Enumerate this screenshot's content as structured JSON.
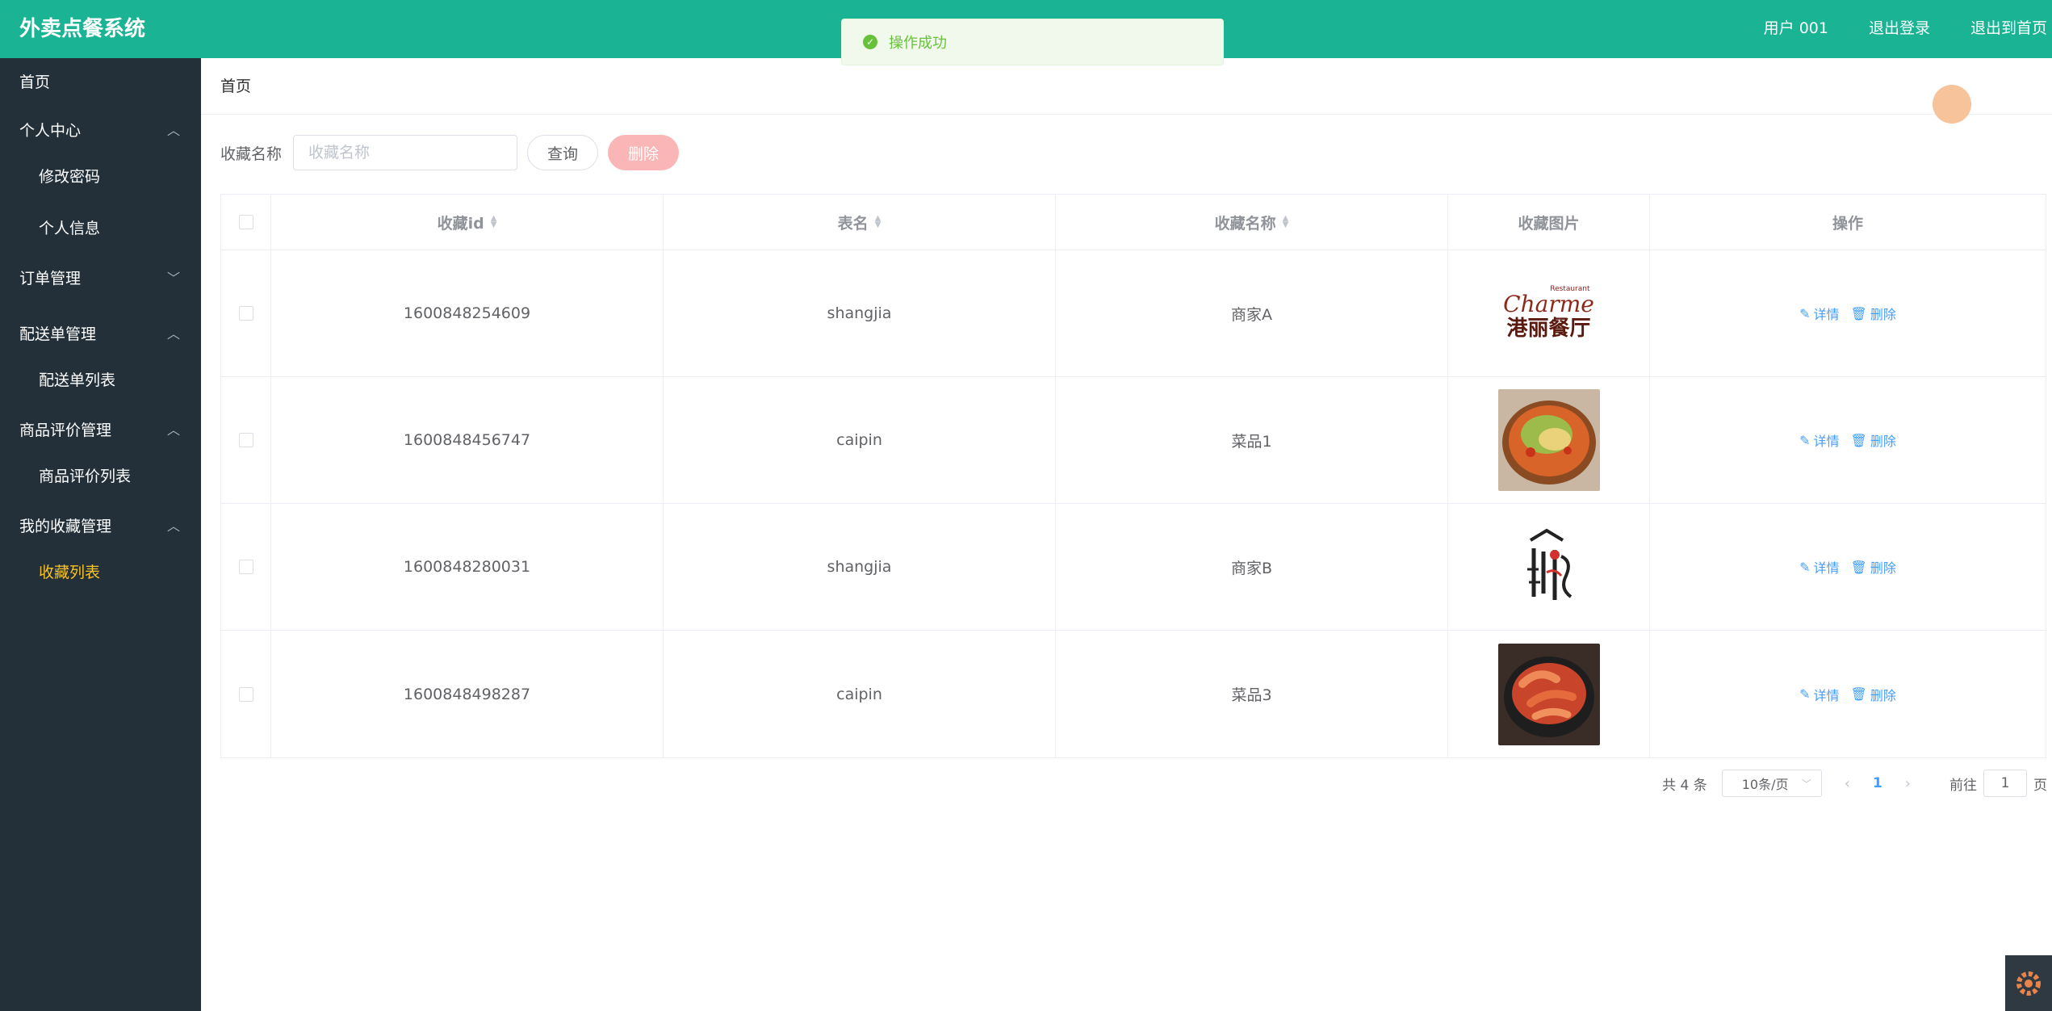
{
  "header": {
    "brand": "外卖点餐系统",
    "user": "用户 001",
    "logout": "退出登录",
    "exit_home": "退出到首页"
  },
  "toast": {
    "message": "操作成功"
  },
  "sidebar": {
    "home": "首页",
    "groups": [
      {
        "label": "个人中心",
        "children": [
          "修改密码",
          "个人信息"
        ]
      },
      {
        "label": "订单管理"
      },
      {
        "label": "配送单管理",
        "children": [
          "配送单列表"
        ]
      },
      {
        "label": "商品评价管理",
        "children": [
          "商品评价列表"
        ]
      },
      {
        "label": "我的收藏管理",
        "children": [
          "收藏列表"
        ]
      }
    ],
    "active": "收藏列表"
  },
  "breadcrumb": "首页",
  "search": {
    "label": "收藏名称",
    "placeholder": "收藏名称",
    "query_btn": "查询",
    "delete_btn": "删除"
  },
  "table": {
    "columns": [
      "收藏id",
      "表名",
      "收藏名称",
      "收藏图片",
      "操作"
    ],
    "rows": [
      {
        "id": "1600848254609",
        "table": "shangjia",
        "name": "商家A"
      },
      {
        "id": "1600848456747",
        "table": "caipin",
        "name": "菜品1"
      },
      {
        "id": "1600848280031",
        "table": "shangjia",
        "name": "商家B"
      },
      {
        "id": "1600848498287",
        "table": "caipin",
        "name": "菜品3"
      }
    ],
    "action_detail": "详情",
    "action_delete": "删除",
    "logo_a": {
      "small": "Restaurant",
      "script": "Charme",
      "cn": "港丽餐厅"
    }
  },
  "pagination": {
    "total": "共 4 条",
    "page_size": "10条/页",
    "current": "1",
    "goto_prefix": "前往",
    "goto_value": "1",
    "goto_suffix": "页"
  },
  "colors": {
    "header": "#1ab394",
    "sidebar": "#23303a",
    "active": "#f7c324",
    "link": "#409eff"
  }
}
